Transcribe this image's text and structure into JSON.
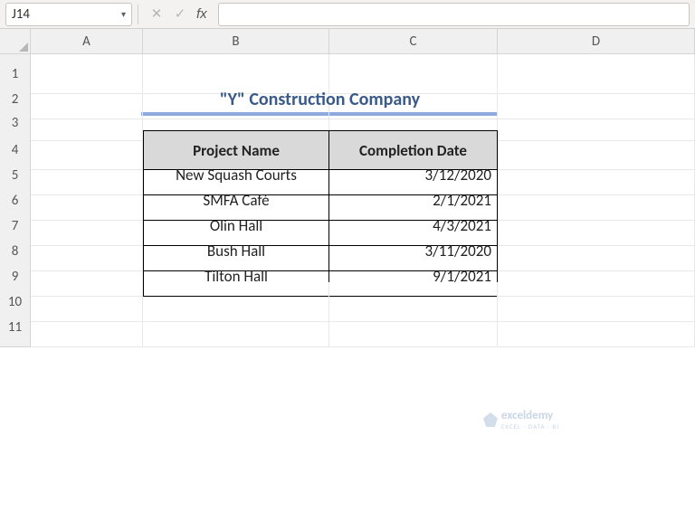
{
  "nameBox": {
    "cellRef": "J14"
  },
  "formulaBar": {
    "value": ""
  },
  "columns": [
    "A",
    "B",
    "C",
    "D"
  ],
  "rows": [
    "1",
    "2",
    "3",
    "4",
    "5",
    "6",
    "7",
    "8",
    "9",
    "10",
    "11"
  ],
  "title": "\"Y\" Construction Company",
  "tableHeaders": {
    "col1": "Project Name",
    "col2": "Completion Date"
  },
  "tableRows": [
    {
      "project": "New Squash Courts",
      "date": "3/12/2020"
    },
    {
      "project": "SMFA Café",
      "date": "2/1/2021"
    },
    {
      "project": "Olin Hall",
      "date": "4/3/2021"
    },
    {
      "project": "Bush Hall",
      "date": "3/11/2020"
    },
    {
      "project": "Tilton Hall",
      "date": "9/1/2021"
    }
  ],
  "watermark": {
    "brand": "exceldemy",
    "tagline": "EXCEL · DATA · BI"
  }
}
